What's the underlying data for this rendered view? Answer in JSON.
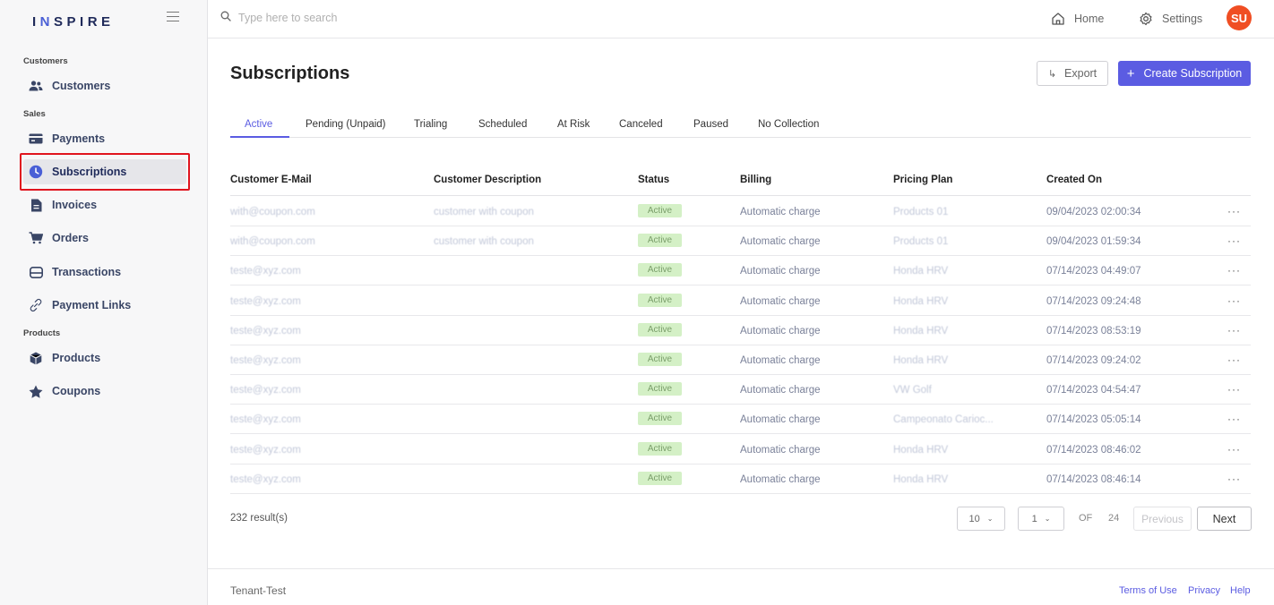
{
  "brand": {
    "logo_text_pre": "I",
    "logo_text_n": "N",
    "logo_text_post": "SPIRE"
  },
  "sidebar": {
    "sections": {
      "customers": "Customers",
      "sales": "Sales",
      "products": "Products"
    },
    "items": [
      {
        "label": "Customers",
        "icon": "users-icon"
      },
      {
        "label": "Payments",
        "icon": "credit-card-icon"
      },
      {
        "label": "Subscriptions",
        "icon": "clock-icon",
        "active": true
      },
      {
        "label": "Invoices",
        "icon": "document-icon"
      },
      {
        "label": "Orders",
        "icon": "cart-icon"
      },
      {
        "label": "Transactions",
        "icon": "inbox-icon"
      },
      {
        "label": "Payment Links",
        "icon": "link-icon"
      },
      {
        "label": "Products",
        "icon": "box-icon"
      },
      {
        "label": "Coupons",
        "icon": "star-icon"
      }
    ]
  },
  "header": {
    "search_placeholder": "Type here to search",
    "home": "Home",
    "settings": "Settings",
    "avatar_initials": "SU"
  },
  "page": {
    "title": "Subscriptions",
    "export_label": "Export",
    "create_label": "Create Subscription"
  },
  "tabs": [
    "Active",
    "Pending (Unpaid)",
    "Trialing",
    "Scheduled",
    "At Risk",
    "Canceled",
    "Paused",
    "No Collection"
  ],
  "table": {
    "columns": [
      "Customer E-Mail",
      "Customer Description",
      "Status",
      "Billing",
      "Pricing Plan",
      "Created On"
    ],
    "rows": [
      {
        "email": "with@coupon.com",
        "description": "customer with coupon",
        "status": "Active",
        "billing": "Automatic charge",
        "plan": "Products 01",
        "created": "09/04/2023 02:00:34"
      },
      {
        "email": "with@coupon.com",
        "description": "customer with coupon",
        "status": "Active",
        "billing": "Automatic charge",
        "plan": "Products 01",
        "created": "09/04/2023 01:59:34"
      },
      {
        "email": "teste@xyz.com",
        "description": "",
        "status": "Active",
        "billing": "Automatic charge",
        "plan": "Honda HRV",
        "created": "07/14/2023 04:49:07"
      },
      {
        "email": "teste@xyz.com",
        "description": "",
        "status": "Active",
        "billing": "Automatic charge",
        "plan": "Honda HRV",
        "created": "07/14/2023 09:24:48"
      },
      {
        "email": "teste@xyz.com",
        "description": "",
        "status": "Active",
        "billing": "Automatic charge",
        "plan": "Honda HRV",
        "created": "07/14/2023 08:53:19"
      },
      {
        "email": "teste@xyz.com",
        "description": "",
        "status": "Active",
        "billing": "Automatic charge",
        "plan": "Honda HRV",
        "created": "07/14/2023 09:24:02"
      },
      {
        "email": "teste@xyz.com",
        "description": "",
        "status": "Active",
        "billing": "Automatic charge",
        "plan": "VW Golf",
        "created": "07/14/2023 04:54:47"
      },
      {
        "email": "teste@xyz.com",
        "description": "",
        "status": "Active",
        "billing": "Automatic charge",
        "plan": "Campeonato Carioc...",
        "created": "07/14/2023 05:05:14"
      },
      {
        "email": "teste@xyz.com",
        "description": "",
        "status": "Active",
        "billing": "Automatic charge",
        "plan": "Honda HRV",
        "created": "07/14/2023 08:46:02"
      },
      {
        "email": "teste@xyz.com",
        "description": "",
        "status": "Active",
        "billing": "Automatic charge",
        "plan": "Honda HRV",
        "created": "07/14/2023 08:46:14"
      }
    ],
    "row_menu": "···"
  },
  "pagination": {
    "results": "232 result(s)",
    "page_size": "10",
    "current_page": "1",
    "of_label": "OF",
    "total_pages": "24",
    "previous": "Previous",
    "next": "Next"
  },
  "footer": {
    "tenant": "Tenant-Test",
    "terms": "Terms of Use",
    "privacy": "Privacy",
    "help": "Help"
  },
  "colors": {
    "accent": "#5b5ce2",
    "avatar": "#f04e23",
    "active_badge_bg": "#d4f0c6",
    "highlight": "#e0141e"
  }
}
